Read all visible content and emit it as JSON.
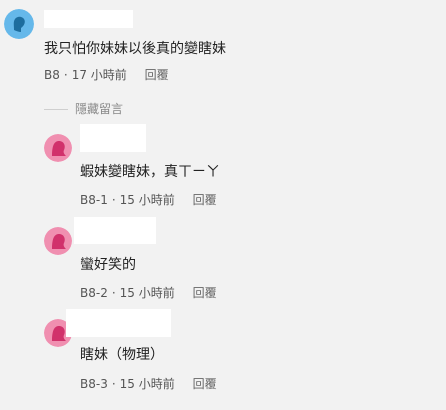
{
  "colors": {
    "background": "#f2f2f2",
    "avatar_blue": "#65b8ea",
    "avatar_pink": "#f08fb0"
  },
  "comments": [
    {
      "avatar_icon": "user-avatar-blue-icon",
      "text": "我只怕你妹妹以後真的變瞎妹",
      "floor": "B8",
      "time": "17 小時前",
      "reply_label": "回覆"
    },
    {
      "avatar_icon": "user-avatar-pink-icon",
      "text": "蝦妹變瞎妹，真ㄒㄧㄚ",
      "floor": "B8-1",
      "time": "15 小時前",
      "reply_label": "回覆"
    },
    {
      "avatar_icon": "user-avatar-pink-icon",
      "text": "蠻好笑的",
      "floor": "B8-2",
      "time": "15 小時前",
      "reply_label": "回覆"
    },
    {
      "avatar_icon": "user-avatar-pink-icon",
      "text": "瞎妹（物理）",
      "floor": "B8-3",
      "time": "15 小時前",
      "reply_label": "回覆"
    }
  ],
  "hide_replies_label": "隱藏留言",
  "meta_separator": "·"
}
